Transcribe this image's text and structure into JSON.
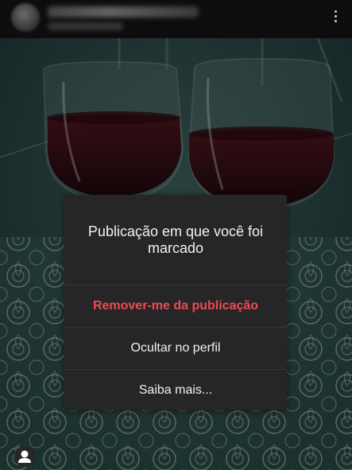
{
  "dialog": {
    "title": "Publicação em que você foi marcado",
    "options": [
      {
        "label": "Remover-me da publicação",
        "style": "danger"
      },
      {
        "label": "Ocultar no perfil",
        "style": "normal"
      },
      {
        "label": "Saiba mais...",
        "style": "normal"
      }
    ]
  },
  "icons": {
    "menu": "more-vertical-icon",
    "tag": "person-tag-icon"
  },
  "colors": {
    "danger": "#ed4956",
    "dialog_bg": "#262626",
    "text": "#f2f2f2"
  }
}
